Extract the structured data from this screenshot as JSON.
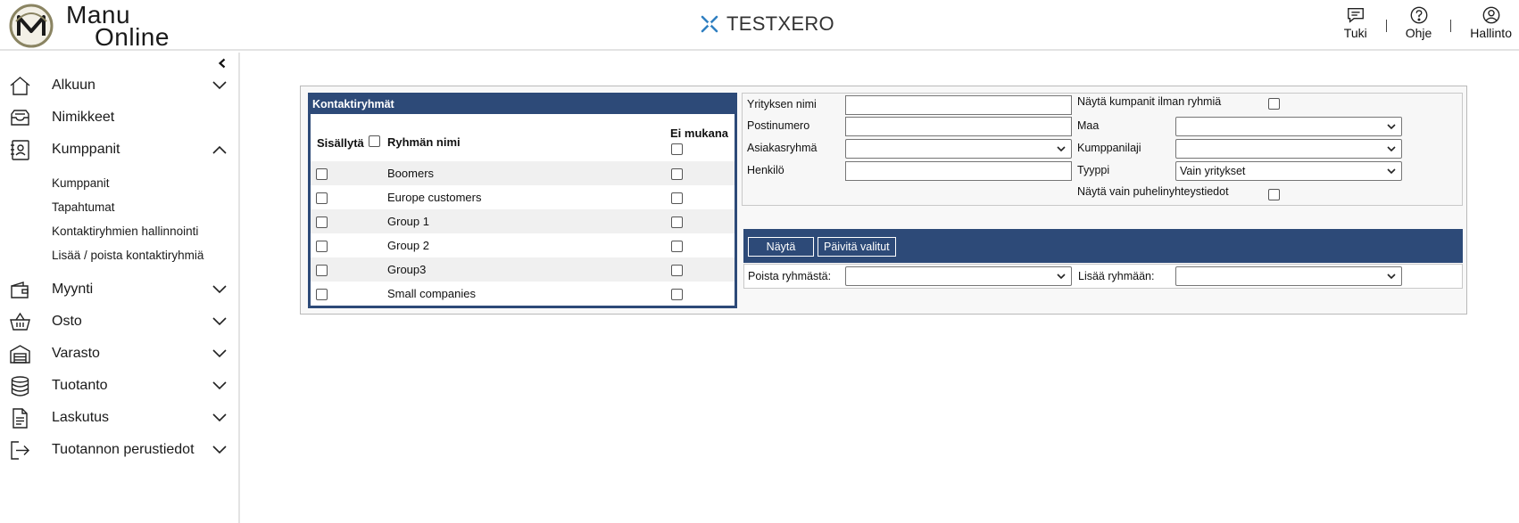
{
  "header": {
    "logo_line1": "Manu",
    "logo_line2": "Online",
    "brand_name": "TESTXERO",
    "actions": [
      {
        "label": "Tuki",
        "icon": "chat-icon"
      },
      {
        "label": "Ohje",
        "icon": "help-icon"
      },
      {
        "label": "Hallinto",
        "icon": "user-icon"
      }
    ],
    "separator": "|"
  },
  "sidebar": {
    "items": [
      {
        "label": "Alkuun",
        "icon": "home-icon",
        "chevron": "down"
      },
      {
        "label": "Nimikkeet",
        "icon": "inbox-icon",
        "chevron": "none"
      },
      {
        "label": "Kumppanit",
        "icon": "contact-card-icon",
        "chevron": "up"
      },
      {
        "label": "Myynti",
        "icon": "wallet-icon",
        "chevron": "down"
      },
      {
        "label": "Osto",
        "icon": "basket-icon",
        "chevron": "down"
      },
      {
        "label": "Varasto",
        "icon": "warehouse-icon",
        "chevron": "down"
      },
      {
        "label": "Tuotanto",
        "icon": "database-icon",
        "chevron": "down"
      },
      {
        "label": "Laskutus",
        "icon": "document-icon",
        "chevron": "down"
      },
      {
        "label": "Tuotannon perustiedot",
        "icon": "exit-icon",
        "chevron": "down"
      }
    ],
    "sub_items": [
      "Kumppanit",
      "Tapahtumat",
      "Kontaktiryhmien hallinnointi",
      "Lisää / poista kontaktiryhmiä"
    ]
  },
  "groups": {
    "title": "Kontaktiryhmät",
    "col_include": "Sisällytä",
    "col_name": "Ryhmän nimi",
    "col_exclude": "Ei mukana",
    "rows": [
      "Boomers",
      "Europe customers",
      "Group 1",
      "Group 2",
      "Group3",
      "Small companies"
    ]
  },
  "filters": {
    "company_name_label": "Yrityksen nimi",
    "postal_label": "Postinumero",
    "customer_group_label": "Asiakasryhmä",
    "person_label": "Henkilö",
    "no_groups_label": "Näytä kumpanit ilman ryhmiä",
    "country_label": "Maa",
    "partner_type_label": "Kumppanilaji",
    "type_label": "Tyyppi",
    "type_value": "Vain yritykset",
    "phone_only_label": "Näytä vain puhelinyhteystiedot"
  },
  "actions": {
    "show_button": "Näytä",
    "update_button": "Päivitä valitut",
    "remove_from_group_label": "Poista ryhmästä:",
    "add_to_group_label": "Lisää ryhmään:"
  },
  "colors": {
    "accent": "#2d4a78",
    "brand_blue": "#2f7fc1",
    "logo_olive": "#8a8462"
  }
}
